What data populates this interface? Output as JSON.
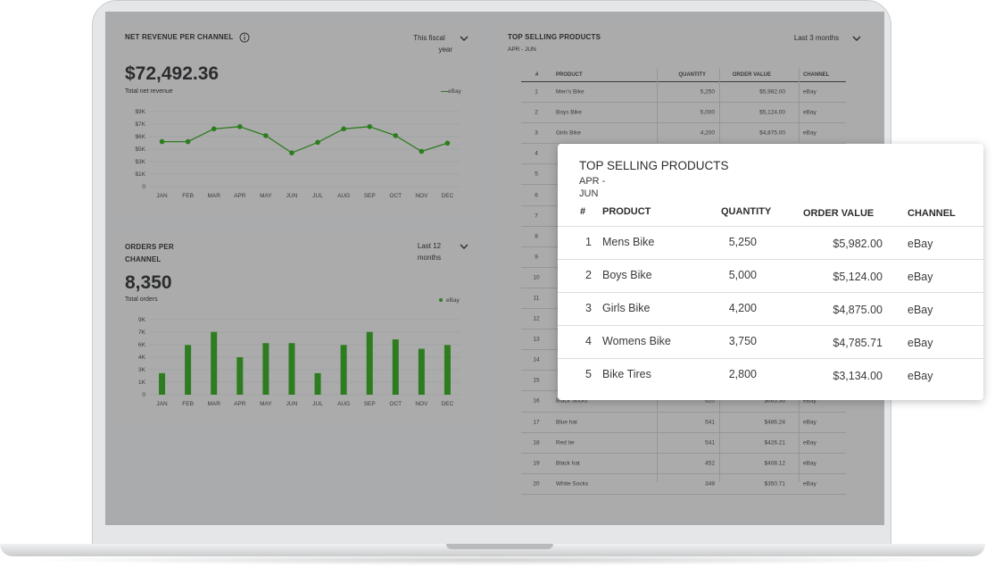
{
  "revenue_card": {
    "title": "NET REVENUE PER CHANNEL",
    "info_icon": "info-icon",
    "period": "This fiscal year",
    "period_line1": "This fiscal",
    "period_line2": "year",
    "value": "$72,492.36",
    "caption": "Total net revenue",
    "legend": "eBay"
  },
  "orders_card": {
    "title_line1": "ORDERS PER",
    "title_line2": "CHANNEL",
    "period_line1": "Last 12",
    "period_line2": "months",
    "value": "8,350",
    "caption": "Total orders",
    "legend": "eBay"
  },
  "products_card": {
    "title": "TOP SELLING PRODUCTS",
    "subtitle": "APR - JUN",
    "period": "Last 3 months",
    "headers": [
      "#",
      "PRODUCT",
      "QUANTITY",
      "ORDER VALUE",
      "CHANNEL"
    ],
    "rows": [
      {
        "n": "1",
        "product": "Men's Bike",
        "qty": "5,250",
        "value": "$5,982.00",
        "channel": "eBay"
      },
      {
        "n": "2",
        "product": "Boys Bike",
        "qty": "5,000",
        "value": "$5,124.00",
        "channel": "eBay"
      },
      {
        "n": "3",
        "product": "Girls Bike",
        "qty": "4,200",
        "value": "$4,875.00",
        "channel": "eBay"
      },
      {
        "n": "4",
        "product": "",
        "qty": "",
        "value": "",
        "channel": ""
      },
      {
        "n": "5",
        "product": "",
        "qty": "",
        "value": "",
        "channel": ""
      },
      {
        "n": "6",
        "product": "",
        "qty": "",
        "value": "",
        "channel": ""
      },
      {
        "n": "7",
        "product": "",
        "qty": "",
        "value": "",
        "channel": ""
      },
      {
        "n": "8",
        "product": "",
        "qty": "",
        "value": "",
        "channel": ""
      },
      {
        "n": "9",
        "product": "",
        "qty": "",
        "value": "",
        "channel": ""
      },
      {
        "n": "10",
        "product": "",
        "qty": "",
        "value": "",
        "channel": ""
      },
      {
        "n": "11",
        "product": "",
        "qty": "",
        "value": "",
        "channel": ""
      },
      {
        "n": "12",
        "product": "",
        "qty": "",
        "value": "",
        "channel": ""
      },
      {
        "n": "13",
        "product": "",
        "qty": "",
        "value": "",
        "channel": ""
      },
      {
        "n": "14",
        "product": "",
        "qty": "",
        "value": "",
        "channel": ""
      },
      {
        "n": "15",
        "product": "",
        "qty": "",
        "value": "",
        "channel": ""
      },
      {
        "n": "16",
        "product": "Black Socks",
        "qty": "620",
        "value": "$663.36",
        "channel": "eBay"
      },
      {
        "n": "17",
        "product": "Blue hat",
        "qty": "541",
        "value": "$486.24",
        "channel": "eBay"
      },
      {
        "n": "18",
        "product": "Red tie",
        "qty": "541",
        "value": "$426.21",
        "channel": "eBay"
      },
      {
        "n": "19",
        "product": "Black hat",
        "qty": "452",
        "value": "$408.12",
        "channel": "eBay"
      },
      {
        "n": "20",
        "product": "White Socks",
        "qty": "349",
        "value": "$350.71",
        "channel": "eBay"
      }
    ]
  },
  "popup": {
    "title": "TOP SELLING PRODUCTS",
    "subtitle_line1": "APR -",
    "subtitle_line2": "JUN",
    "headers": [
      "#",
      "PRODUCT",
      "QUANTITY",
      "ORDER VALUE",
      "CHANNEL"
    ],
    "rows": [
      {
        "n": "1",
        "product": "Mens Bike",
        "qty": "5,250",
        "value": "$5,982.00",
        "channel": "eBay"
      },
      {
        "n": "2",
        "product": "Boys Bike",
        "qty": "5,000",
        "value": "$5,124.00",
        "channel": "eBay"
      },
      {
        "n": "3",
        "product": "Girls Bike",
        "qty": "4,200",
        "value": "$4,875.00",
        "channel": "eBay"
      },
      {
        "n": "4",
        "product": "Womens Bike",
        "qty": "3,750",
        "value": "$4,785.71",
        "channel": "eBay"
      },
      {
        "n": "5",
        "product": "Bike Tires",
        "qty": "2,800",
        "value": "$3,134.00",
        "channel": "eBay"
      }
    ]
  },
  "colors": {
    "series": "#2ca01c",
    "series_dark": "#2d7d20"
  },
  "chart_data": [
    {
      "type": "line",
      "title": "NET REVENUE PER CHANNEL",
      "categories": [
        "JAN",
        "FEB",
        "MAR",
        "APR",
        "MAY",
        "JUN",
        "JUL",
        "AUG",
        "SEP",
        "OCT",
        "NOV",
        "DEC"
      ],
      "y_ticks": [
        "0",
        "$1K",
        "$3K",
        "$5K",
        "$6K",
        "$7K",
        "$9K"
      ],
      "series": [
        {
          "name": "eBay",
          "values": [
            6.0,
            6.0,
            7.7,
            8.0,
            6.8,
            4.5,
            5.9,
            7.7,
            8.0,
            6.8,
            4.7,
            5.8
          ]
        }
      ],
      "ylim": [
        0,
        10
      ],
      "legend": "top-right"
    },
    {
      "type": "bar",
      "title": "ORDERS PER CHANNEL",
      "categories": [
        "JAN",
        "FEB",
        "MAR",
        "APR",
        "MAY",
        "JUN",
        "JUL",
        "AUG",
        "SEP",
        "OCT",
        "NOV",
        "DEC"
      ],
      "y_ticks": [
        "0",
        "1K",
        "3K",
        "4K",
        "6K",
        "7K",
        "9K"
      ],
      "series": [
        {
          "name": "eBay",
          "values": [
            2.3,
            5.3,
            6.7,
            4.0,
            5.5,
            5.5,
            2.3,
            5.3,
            6.7,
            5.9,
            4.9,
            5.3
          ]
        }
      ],
      "ylim": [
        0,
        8
      ]
    }
  ]
}
